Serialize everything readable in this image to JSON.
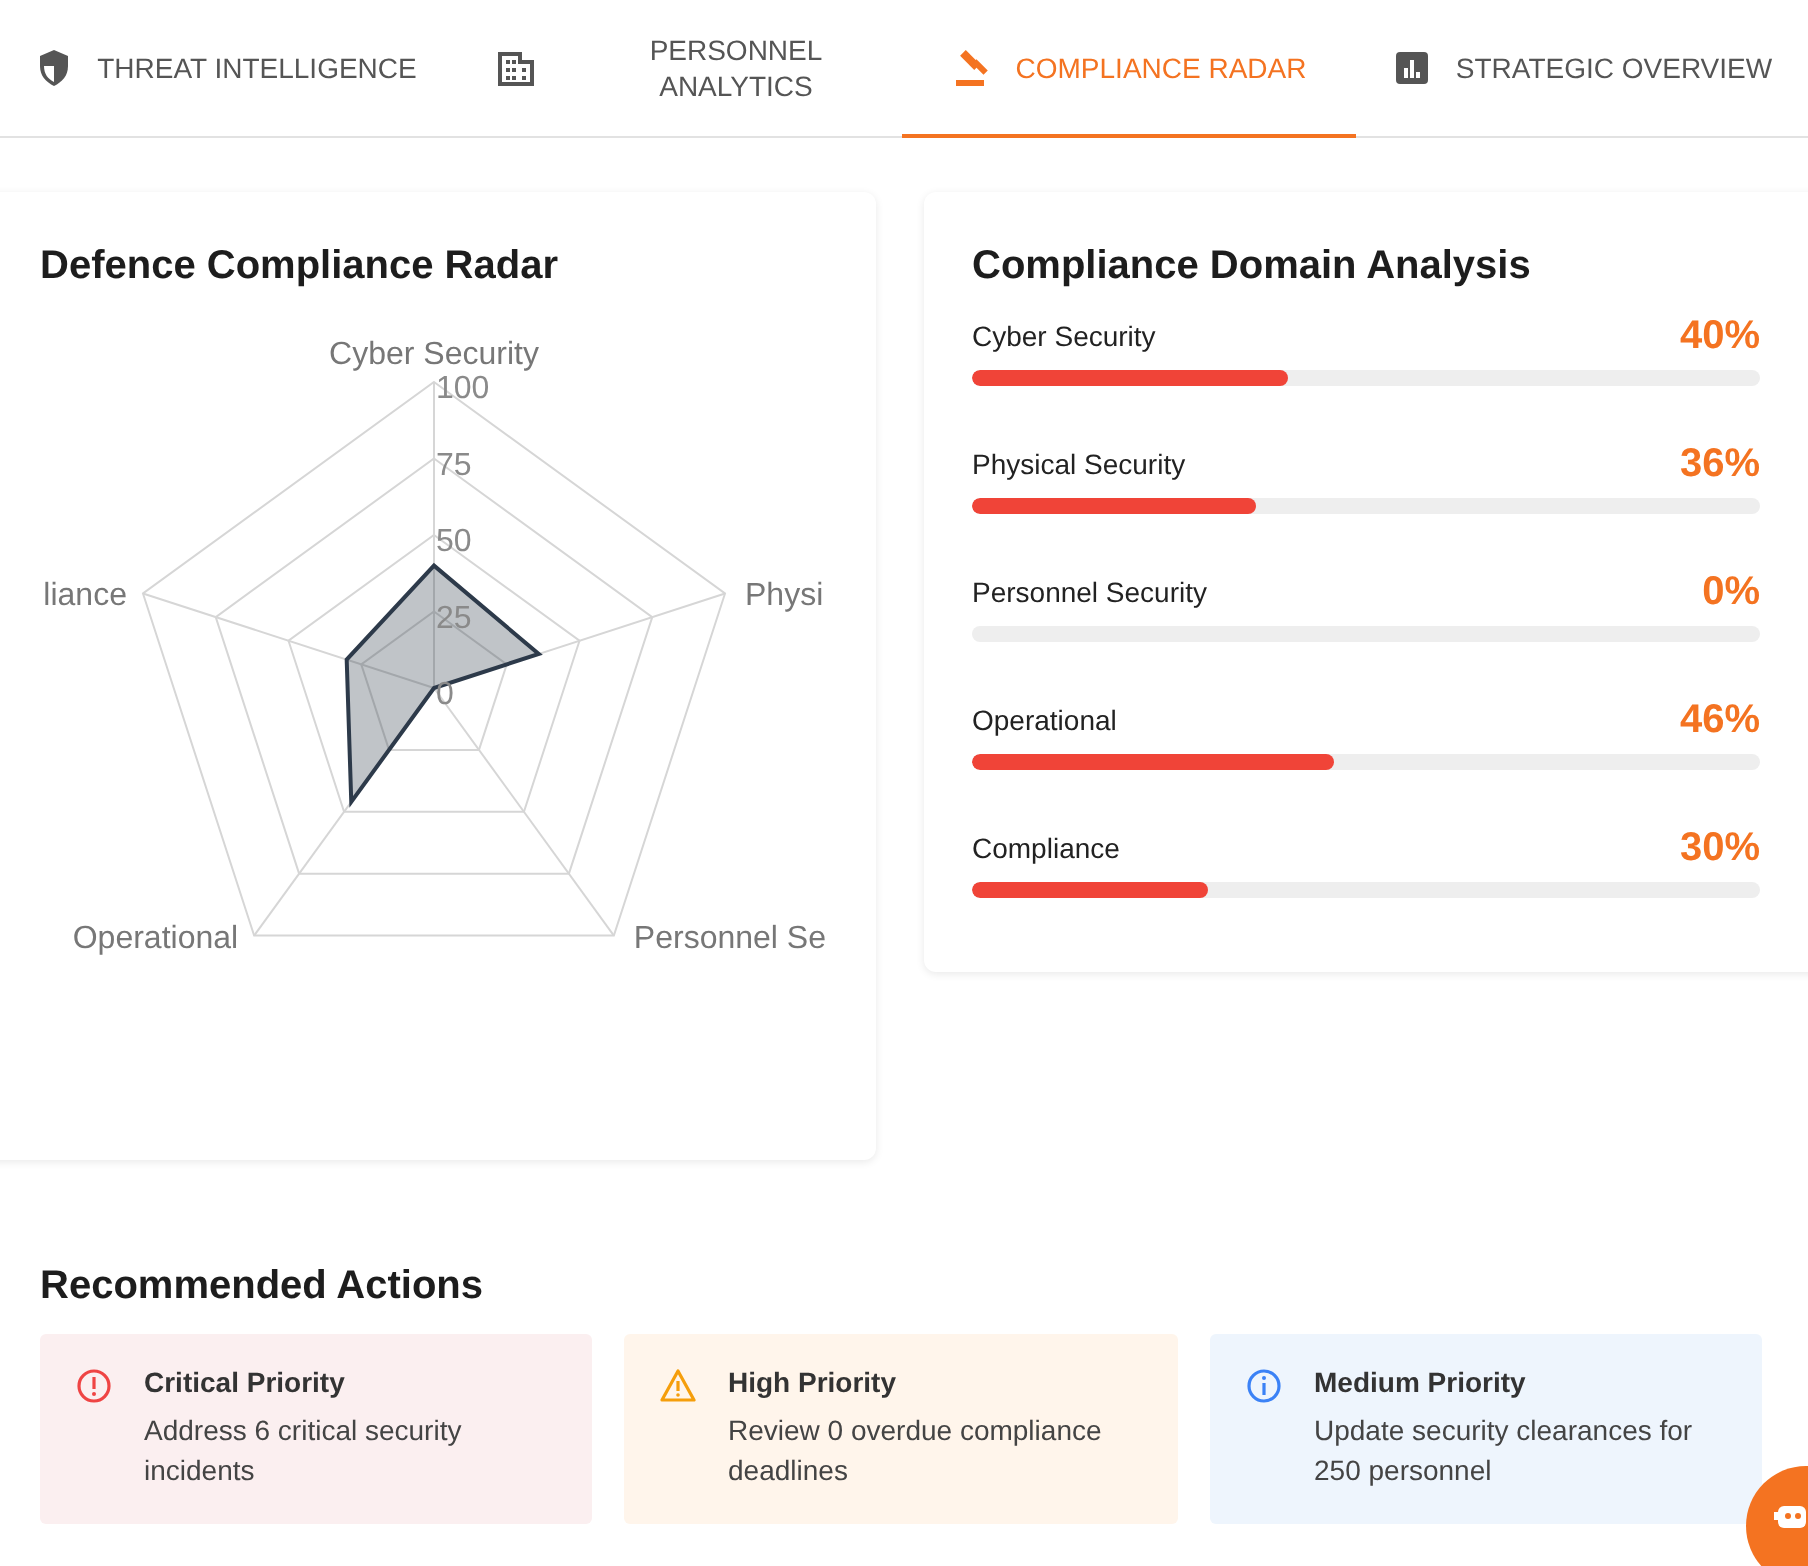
{
  "tabs": [
    {
      "label": "THREAT INTELLIGENCE",
      "selected": false
    },
    {
      "label": "PERSONNEL ANALYTICS",
      "selected": false
    },
    {
      "label": "COMPLIANCE RADAR",
      "selected": true
    },
    {
      "label": "STRATEGIC OVERVIEW",
      "selected": false
    }
  ],
  "radar_card": {
    "title": "Defence Compliance Radar",
    "axis_labels": [
      "Cyber Security",
      "Physi",
      "Personnel Se",
      "Operational",
      "liance"
    ],
    "ticks": [
      "100",
      "75",
      "50",
      "25",
      "0"
    ]
  },
  "domain_card": {
    "title": "Compliance Domain Analysis",
    "domains": [
      {
        "name": "Cyber Security",
        "percent": "40%",
        "level": 0.4
      },
      {
        "name": "Physical Security",
        "percent": "36%",
        "level": 0.36
      },
      {
        "name": "Personnel Security",
        "percent": "0%",
        "level": 0
      },
      {
        "name": "Operational",
        "percent": "46%",
        "level": 0.46
      },
      {
        "name": "Compliance",
        "percent": "30%",
        "level": 0.3
      }
    ]
  },
  "actions": {
    "title": "Recommended Actions",
    "items": [
      {
        "kind": "critical",
        "title": "Critical Priority",
        "text": "Address 6 critical security incidents"
      },
      {
        "kind": "high",
        "title": "High Priority",
        "text": "Review 0 overdue compliance deadlines"
      },
      {
        "kind": "medium",
        "title": "Medium Priority",
        "text": "Update security clearances for 250 personnel"
      }
    ]
  }
}
